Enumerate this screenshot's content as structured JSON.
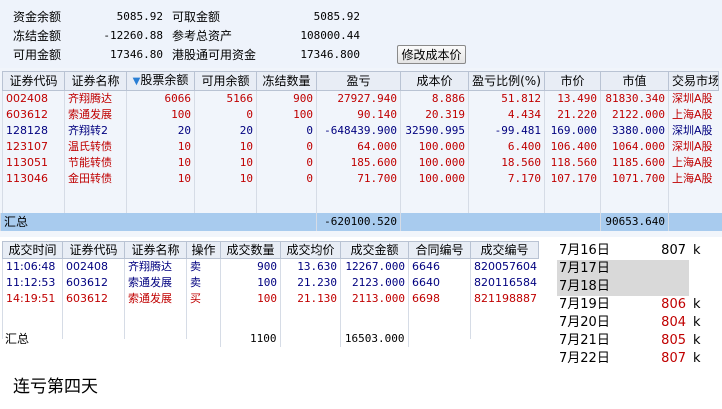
{
  "summary": {
    "fund_balance_label": "资金余额",
    "fund_balance": "5085.92",
    "withdrawable_label": "可取金额",
    "withdrawable": "5085.92",
    "frozen_label": "冻结金额",
    "frozen": "-12260.88",
    "ref_total_label": "参考总资产",
    "ref_total": "108000.44",
    "available_label": "可用金额",
    "available": "17346.80",
    "hk_available_label": "港股通可用资金",
    "hk_available": "17346.800",
    "modify_cost_label": "修改成本价"
  },
  "positions": {
    "headers": [
      "证券代码",
      "证券名称",
      "股票余额",
      "可用余额",
      "冻结数量",
      "盈亏",
      "成本价",
      "盈亏比例(%)",
      "市价",
      "市值",
      "交易市场"
    ],
    "rows": [
      {
        "code": "002408",
        "name": "齐翔腾达",
        "balance": "6066",
        "available": "5166",
        "frozen": "900",
        "pnl": "27927.940",
        "cost": "8.886",
        "ratio": "51.812",
        "price": "13.490",
        "value": "81830.340",
        "market": "深圳A股",
        "color": "red"
      },
      {
        "code": "603612",
        "name": "索通发展",
        "balance": "100",
        "available": "0",
        "frozen": "100",
        "pnl": "90.140",
        "cost": "20.319",
        "ratio": "4.434",
        "price": "21.220",
        "value": "2122.000",
        "market": "上海A股",
        "color": "red"
      },
      {
        "code": "128128",
        "name": "齐翔转2",
        "balance": "20",
        "available": "20",
        "frozen": "0",
        "pnl": "-648439.900",
        "cost": "32590.995",
        "ratio": "-99.481",
        "price": "169.000",
        "value": "3380.000",
        "market": "深圳A股",
        "color": "blue"
      },
      {
        "code": "123107",
        "name": "温氏转债",
        "balance": "10",
        "available": "10",
        "frozen": "0",
        "pnl": "64.000",
        "cost": "100.000",
        "ratio": "6.400",
        "price": "106.400",
        "value": "1064.000",
        "market": "深圳A股",
        "color": "red"
      },
      {
        "code": "113051",
        "name": "节能转债",
        "balance": "10",
        "available": "10",
        "frozen": "0",
        "pnl": "185.600",
        "cost": "100.000",
        "ratio": "18.560",
        "price": "118.560",
        "value": "1185.600",
        "market": "上海A股",
        "color": "red"
      },
      {
        "code": "113046",
        "name": "金田转债",
        "balance": "10",
        "available": "10",
        "frozen": "0",
        "pnl": "71.700",
        "cost": "100.000",
        "ratio": "7.170",
        "price": "107.170",
        "value": "1071.700",
        "market": "上海A股",
        "color": "red"
      }
    ],
    "total_label": "汇总",
    "total_pnl": "-620100.520",
    "total_value": "90653.640"
  },
  "trades": {
    "headers": [
      "成交时间",
      "证券代码",
      "证券名称",
      "操作",
      "成交数量",
      "成交均价",
      "成交金额",
      "合同编号",
      "成交编号"
    ],
    "rows": [
      {
        "time": "11:06:48",
        "code": "002408",
        "name": "齐翔腾达",
        "op": "卖",
        "qty": "900",
        "avg": "13.630",
        "amount": "12267.000",
        "contract": "6646",
        "deal": "820057604",
        "color": "blue"
      },
      {
        "time": "11:12:53",
        "code": "603612",
        "name": "索通发展",
        "op": "卖",
        "qty": "100",
        "avg": "21.230",
        "amount": "2123.000",
        "contract": "6640",
        "deal": "820116584",
        "color": "blue"
      },
      {
        "time": "14:19:51",
        "code": "603612",
        "name": "索通发展",
        "op": "买",
        "qty": "100",
        "avg": "21.130",
        "amount": "2113.000",
        "contract": "6698",
        "deal": "821198887",
        "color": "red"
      }
    ],
    "total_label": "汇总",
    "total_qty": "1100",
    "total_amount": "16503.000"
  },
  "daily": [
    {
      "date": "7月16日",
      "val": "807",
      "unit": "k",
      "color": "#000000",
      "shaded": false
    },
    {
      "date": "7月17日",
      "val": "",
      "unit": "",
      "color": "#000000",
      "shaded": true
    },
    {
      "date": "7月18日",
      "val": "",
      "unit": "",
      "color": "#000000",
      "shaded": true
    },
    {
      "date": "7月19日",
      "val": "806",
      "unit": "k",
      "color": "#c00000",
      "shaded": false
    },
    {
      "date": "7月20日",
      "val": "804",
      "unit": "k",
      "color": "#c00000",
      "shaded": false
    },
    {
      "date": "7月21日",
      "val": "805",
      "unit": "k",
      "color": "#c00000",
      "shaded": false
    },
    {
      "date": "7月22日",
      "val": "807",
      "unit": "k",
      "color": "#c00000",
      "shaded": false
    }
  ],
  "caption": "连亏第四天"
}
